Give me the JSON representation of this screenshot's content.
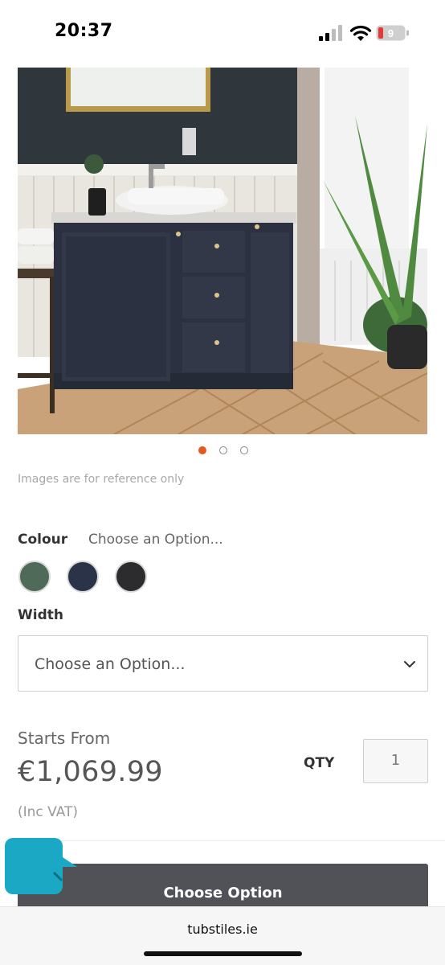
{
  "status_bar": {
    "time": "20:37",
    "battery_level": "9",
    "signal_icon": "cellular-signal-icon",
    "wifi_icon": "wifi-icon",
    "battery_icon": "battery-icon"
  },
  "gallery": {
    "image_description_icon": "product-photo",
    "slide_count": 3,
    "active_slide": 1,
    "note": "Images are for reference only",
    "accent_color": "#e8581c"
  },
  "options": {
    "colour_label": "Colour",
    "colour_value": "Choose an Option...",
    "swatches": [
      {
        "color": "#4f6a58"
      },
      {
        "color": "#2a3347"
      },
      {
        "color": "#2c2c2e"
      }
    ],
    "width_label": "Width",
    "width_select_value": "Choose an Option...",
    "chevron_icon": "chevron-down-icon"
  },
  "pricing": {
    "starts_from": "Starts From",
    "price": "€1,069.99",
    "vat_note": "(Inc VAT)"
  },
  "quantity": {
    "label": "QTY",
    "value": "1"
  },
  "cta": {
    "label": "Choose Option",
    "color": "#505258"
  },
  "chat": {
    "icon": "chat-bubble-icon",
    "color": "#1aa8c4"
  },
  "browser": {
    "url": "tubstiles.ie"
  }
}
